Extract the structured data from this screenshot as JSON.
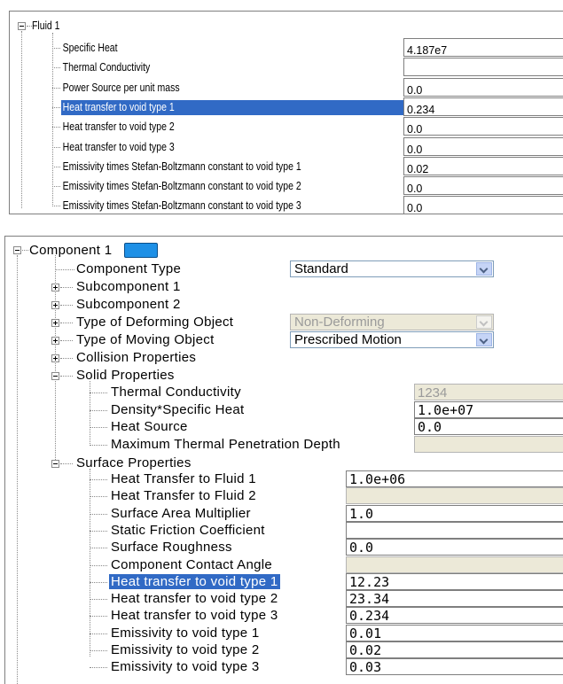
{
  "fluid_panel": {
    "title": "Fluid 1",
    "rows": [
      {
        "label": "Specific Heat",
        "value": "4.187e7",
        "selected": false
      },
      {
        "label": "Thermal Conductivity",
        "value": "",
        "selected": false
      },
      {
        "label": "Power Source per unit mass",
        "value": "0.0",
        "selected": false
      },
      {
        "label": "Heat transfer to void type 1",
        "value": "0.234",
        "selected": true
      },
      {
        "label": "Heat transfer to void type 2",
        "value": "0.0",
        "selected": false
      },
      {
        "label": "Heat transfer to void type 3",
        "value": "0.0",
        "selected": false
      },
      {
        "label": "Emissivity times Stefan-Boltzmann constant to void type 1",
        "value": "0.02",
        "selected": false
      },
      {
        "label": "Emissivity times Stefan-Boltzmann constant to void type 2",
        "value": "0.0",
        "selected": false
      },
      {
        "label": "Emissivity times Stefan-Boltzmann constant to void type 3",
        "value": "0.0",
        "selected": false
      }
    ]
  },
  "component_panel": {
    "title": "Component 1",
    "swatch_color": "#1e90e6",
    "component_type": {
      "label": "Component Type",
      "value": "Standard"
    },
    "subcomponent_1": "Subcomponent 1",
    "subcomponent_2": "Subcomponent 2",
    "deforming": {
      "label": "Type of Deforming Object",
      "value": "Non-Deforming",
      "disabled": true
    },
    "moving": {
      "label": "Type of Moving Object",
      "value": "Prescribed Motion"
    },
    "collision": "Collision Properties",
    "solid": {
      "title": "Solid Properties",
      "rows": [
        {
          "label": "Thermal Conductivity",
          "value": "1234",
          "disabled": true
        },
        {
          "label": "Density*Specific Heat",
          "value": "1.0e+07",
          "disabled": false
        },
        {
          "label": "Heat Source",
          "value": "0.0",
          "disabled": false
        },
        {
          "label": "Maximum Thermal Penetration Depth",
          "value": "",
          "disabled": true
        }
      ]
    },
    "surface": {
      "title": "Surface Properties",
      "rows": [
        {
          "label": "Heat Transfer to Fluid 1",
          "value": "1.0e+06",
          "disabled": false,
          "selected": false
        },
        {
          "label": "Heat Transfer to Fluid 2",
          "value": "",
          "disabled": true,
          "selected": false
        },
        {
          "label": "Surface Area Multiplier",
          "value": "1.0",
          "disabled": false,
          "selected": false
        },
        {
          "label": "Static Friction Coefficient",
          "value": "",
          "disabled": false,
          "selected": false
        },
        {
          "label": "Surface Roughness",
          "value": "0.0",
          "disabled": false,
          "selected": false
        },
        {
          "label": "Component Contact Angle",
          "value": "",
          "disabled": true,
          "selected": false
        },
        {
          "label": "Heat transfer to void type 1",
          "value": "12.23",
          "disabled": false,
          "selected": true
        },
        {
          "label": "Heat transfer to void type 2",
          "value": "23.34",
          "disabled": false,
          "selected": false
        },
        {
          "label": "Heat transfer to void type 3",
          "value": "0.234",
          "disabled": false,
          "selected": false
        },
        {
          "label": "Emissivity to void type 1",
          "value": "0.01",
          "disabled": false,
          "selected": false
        },
        {
          "label": "Emissivity to void type 2",
          "value": "0.02",
          "disabled": false,
          "selected": false
        },
        {
          "label": "Emissivity to void type 3",
          "value": "0.03",
          "disabled": false,
          "selected": false
        }
      ]
    }
  }
}
